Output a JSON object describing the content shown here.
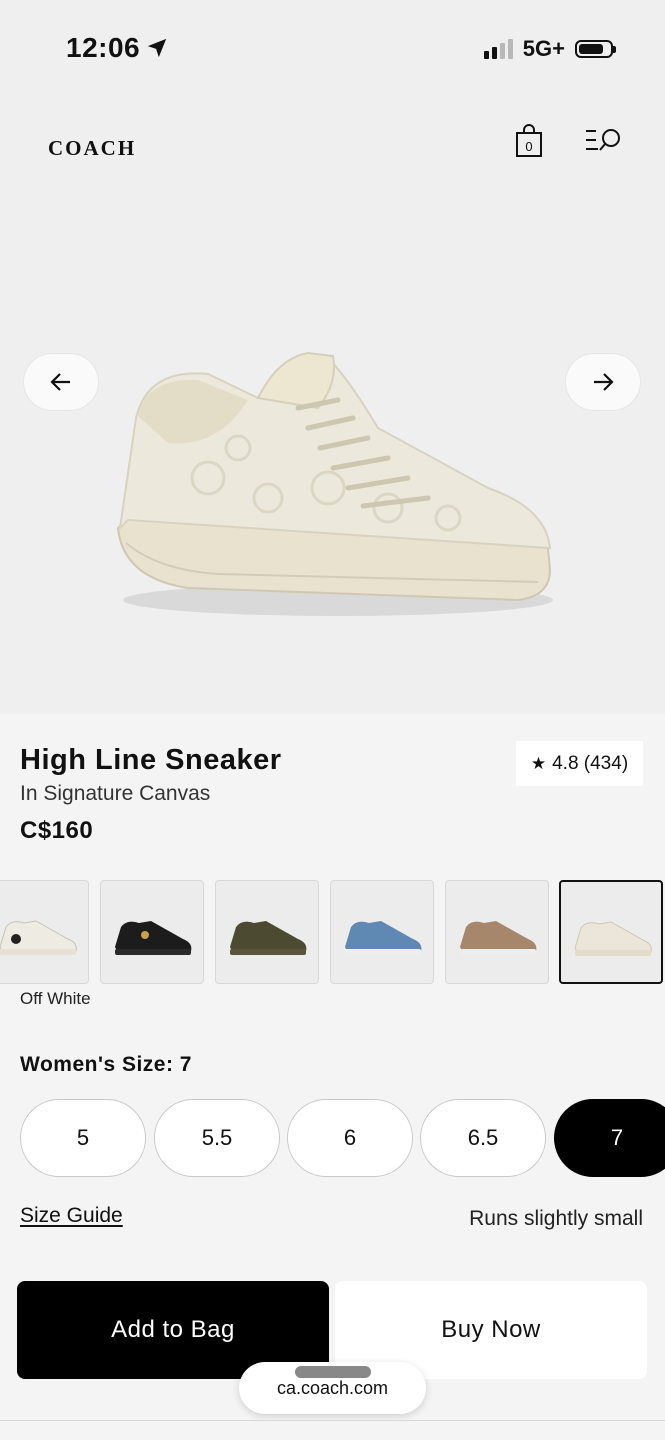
{
  "status_bar": {
    "time": "12:06",
    "network": "5G+",
    "signal_bars_filled": 2,
    "signal_bars_total": 4,
    "battery_level": 0.7
  },
  "header": {
    "logo": "COACH",
    "bag_count": "0"
  },
  "product": {
    "name": "High Line Sneaker",
    "subtitle": "In Signature Canvas",
    "price": "C$160",
    "rating": "4.8 (434)",
    "selected_color": "Off White",
    "swatches": [
      {
        "color": "#eeebe2",
        "accent": "#222222"
      },
      {
        "color": "#1c1c1c",
        "accent": "#c9a449"
      },
      {
        "color": "#4d4a32",
        "accent": "#d9d2bf"
      },
      {
        "color": "#5f88b3",
        "accent": "#eeeeee"
      },
      {
        "color": "#a7876c",
        "accent": "#eeeeee"
      },
      {
        "color": "#ebe6d9",
        "accent": "#d8d2c2"
      }
    ],
    "selected_swatch_index": 5
  },
  "size": {
    "label": "Women's Size: 7",
    "options": [
      "5",
      "5.5",
      "6",
      "6.5",
      "7"
    ],
    "selected": "7",
    "guide_link": "Size Guide",
    "fit_note": "Runs slightly small"
  },
  "actions": {
    "add_to_bag": "Add to Bag",
    "buy_now": "Buy Now"
  },
  "browser": {
    "url": "ca.coach.com"
  }
}
